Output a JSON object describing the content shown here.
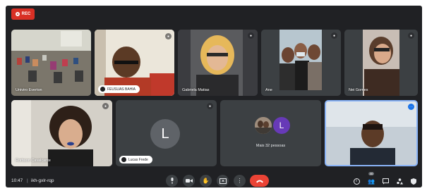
{
  "recording": {
    "label": "REC"
  },
  "participants": [
    {
      "name": "Univiro Everton"
    },
    {
      "name": "FEUSUAS BAHIA"
    },
    {
      "name": "Gabriela Matias"
    },
    {
      "name": "Ane"
    },
    {
      "name": "Nei Gomes"
    },
    {
      "name": "Rorbson Cavalcante"
    },
    {
      "name": "Lucas Frede",
      "initial": "L"
    },
    {
      "more_label": "Mais 32 pessoas",
      "initial": "L"
    },
    {
      "name": ""
    }
  ],
  "footer": {
    "time": "10:47",
    "meeting_code": "ikh-gxlr-rqp",
    "people_count": "40"
  },
  "icons": {
    "mic": "mic-icon",
    "camera": "camera-icon",
    "hand": "raise-hand-icon",
    "present": "present-icon",
    "more": "more-options-icon",
    "hangup": "hang-up-icon",
    "info": "info-icon",
    "people": "people-icon",
    "chat": "chat-icon",
    "activities": "activities-icon",
    "host": "host-controls-icon"
  },
  "colors": {
    "background": "#202124",
    "tile": "#3c4043",
    "record": "#d93025",
    "hangup": "#ea4335",
    "avatar": "#5f6368",
    "avatar_purple": "#673ab7",
    "speaker_border": "#8ab4f8"
  }
}
